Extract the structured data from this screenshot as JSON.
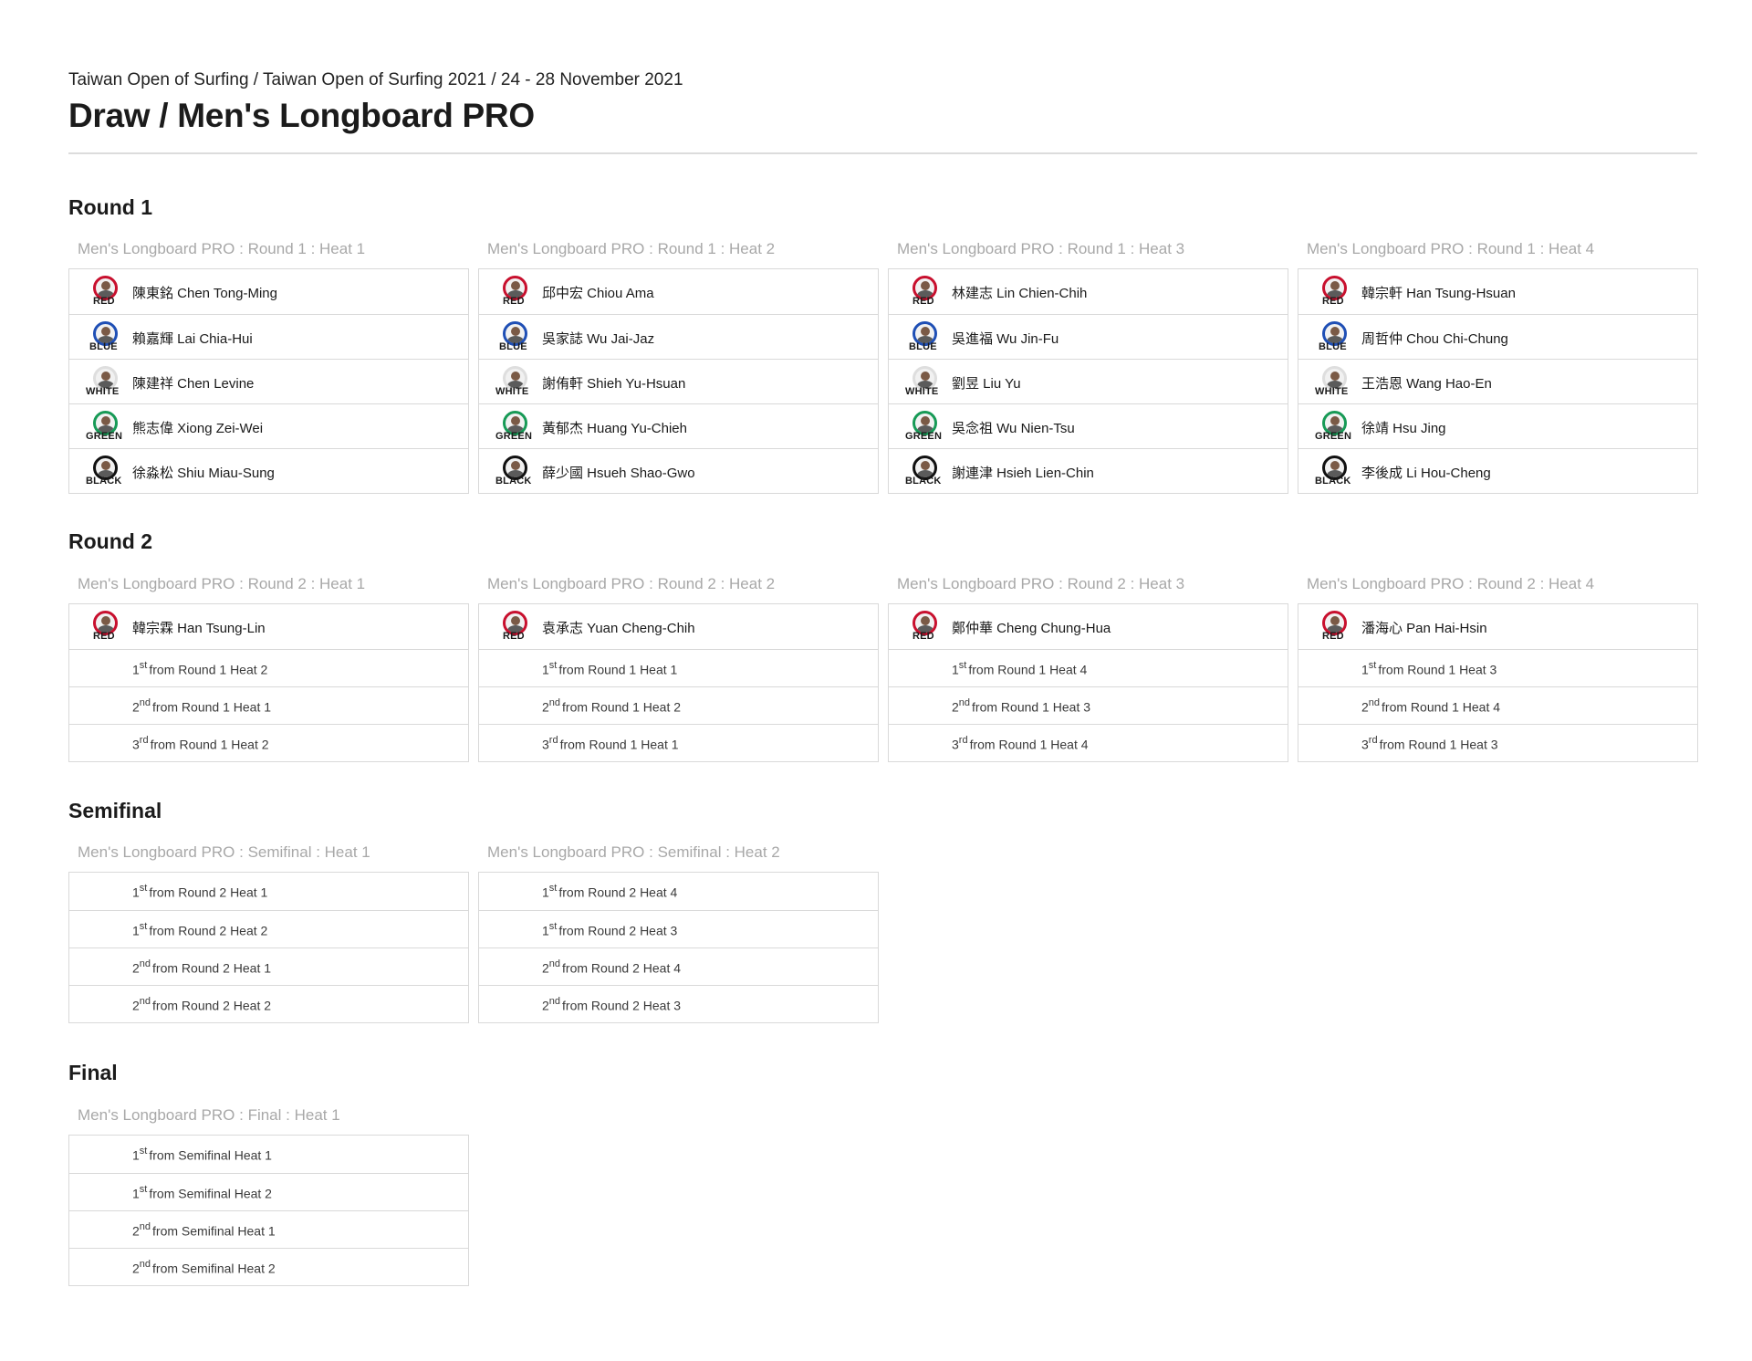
{
  "breadcrumb": "Taiwan Open of Surfing / Taiwan Open of Surfing 2021 / 24 - 28 November 2021",
  "title": "Draw / Men's Longboard PRO",
  "colors": {
    "RED": "#c8102e",
    "BLUE": "#1f4fb5",
    "WHITE": "#dedede",
    "GREEN": "#179a56",
    "BLACK": "#111111"
  },
  "rounds": [
    {
      "title": "Round 1",
      "heats": [
        {
          "label": "Men's Longboard PRO : Round 1 : Heat 1",
          "rows": [
            {
              "type": "surfer",
              "name": "陳東銘 Chen Tong-Ming",
              "color": "RED",
              "icon": "surfer-photo"
            },
            {
              "type": "surfer",
              "name": "賴嘉輝 Lai Chia-Hui",
              "color": "BLUE",
              "icon": "surfer-photo"
            },
            {
              "type": "surfer",
              "name": "陳建祥 Chen Levine",
              "color": "WHITE",
              "icon": "surfer-photo"
            },
            {
              "type": "surfer",
              "name": "熊志偉 Xiong Zei-Wei",
              "color": "GREEN",
              "icon": "surfer-photo"
            },
            {
              "type": "surfer",
              "name": "徐淼松 Shiu Miau-Sung",
              "color": "BLACK",
              "icon": "surfer-photo"
            }
          ]
        },
        {
          "label": "Men's Longboard PRO : Round 1 : Heat 2",
          "rows": [
            {
              "type": "surfer",
              "name": "邱中宏 Chiou Ama",
              "color": "RED",
              "icon": "surfer-photo"
            },
            {
              "type": "surfer",
              "name": "吳家誌 Wu Jai-Jaz",
              "color": "BLUE",
              "icon": "surfer-photo"
            },
            {
              "type": "surfer",
              "name": "謝侑軒 Shieh Yu-Hsuan",
              "color": "WHITE",
              "icon": "surfer-photo"
            },
            {
              "type": "surfer",
              "name": "黃郁杰 Huang Yu-Chieh",
              "color": "GREEN",
              "icon": "surfer-photo"
            },
            {
              "type": "surfer",
              "name": "薛少國 Hsueh Shao-Gwo",
              "color": "BLACK",
              "icon": "surfer-photo"
            }
          ]
        },
        {
          "label": "Men's Longboard PRO : Round 1 : Heat 3",
          "rows": [
            {
              "type": "surfer",
              "name": "林建志 Lin Chien-Chih",
              "color": "RED",
              "icon": "surfer-photo"
            },
            {
              "type": "surfer",
              "name": "吳進福 Wu Jin-Fu",
              "color": "BLUE",
              "icon": "surfer-photo"
            },
            {
              "type": "surfer",
              "name": "劉昱 Liu Yu",
              "color": "WHITE",
              "icon": "surfer-photo"
            },
            {
              "type": "surfer",
              "name": "吳念祖 Wu Nien-Tsu",
              "color": "GREEN",
              "icon": "surfer-photo"
            },
            {
              "type": "surfer",
              "name": "謝連津 Hsieh Lien-Chin",
              "color": "BLACK",
              "icon": "surfer-photo"
            }
          ]
        },
        {
          "label": "Men's Longboard PRO : Round 1 : Heat 4",
          "rows": [
            {
              "type": "surfer",
              "name": "韓宗軒 Han Tsung-Hsuan",
              "color": "RED",
              "icon": "surfer-photo"
            },
            {
              "type": "surfer",
              "name": "周哲仲 Chou Chi-Chung",
              "color": "BLUE",
              "icon": "surfer-photo"
            },
            {
              "type": "surfer",
              "name": "王浩恩 Wang Hao-En",
              "color": "WHITE",
              "icon": "surfer-photo"
            },
            {
              "type": "surfer",
              "name": "徐靖 Hsu Jing",
              "color": "GREEN",
              "icon": "surfer-photo"
            },
            {
              "type": "surfer",
              "name": "李後成 Li Hou-Cheng",
              "color": "BLACK",
              "icon": "surfer-photo"
            }
          ]
        }
      ]
    },
    {
      "title": "Round 2",
      "heats": [
        {
          "label": "Men's Longboard PRO : Round 2 : Heat 1",
          "rows": [
            {
              "type": "surfer",
              "name": "韓宗霖 Han Tsung-Lin",
              "color": "RED",
              "icon": "surfer-photo"
            },
            {
              "type": "slot",
              "place": "1",
              "suffix": "st",
              "text": "from Round 1 Heat 2"
            },
            {
              "type": "slot",
              "place": "2",
              "suffix": "nd",
              "text": "from Round 1 Heat 1"
            },
            {
              "type": "slot",
              "place": "3",
              "suffix": "rd",
              "text": "from Round 1 Heat 2"
            }
          ]
        },
        {
          "label": "Men's Longboard PRO : Round 2 : Heat 2",
          "rows": [
            {
              "type": "surfer",
              "name": "袁承志 Yuan Cheng-Chih",
              "color": "RED",
              "icon": "surfer-photo"
            },
            {
              "type": "slot",
              "place": "1",
              "suffix": "st",
              "text": "from Round 1 Heat 1"
            },
            {
              "type": "slot",
              "place": "2",
              "suffix": "nd",
              "text": "from Round 1 Heat 2"
            },
            {
              "type": "slot",
              "place": "3",
              "suffix": "rd",
              "text": "from Round 1 Heat 1"
            }
          ]
        },
        {
          "label": "Men's Longboard PRO : Round 2 : Heat 3",
          "rows": [
            {
              "type": "surfer",
              "name": "鄭仲華 Cheng Chung-Hua",
              "color": "RED",
              "icon": "surfer-photo"
            },
            {
              "type": "slot",
              "place": "1",
              "suffix": "st",
              "text": "from Round 1 Heat 4"
            },
            {
              "type": "slot",
              "place": "2",
              "suffix": "nd",
              "text": "from Round 1 Heat 3"
            },
            {
              "type": "slot",
              "place": "3",
              "suffix": "rd",
              "text": "from Round 1 Heat 4"
            }
          ]
        },
        {
          "label": "Men's Longboard PRO : Round 2 : Heat 4",
          "rows": [
            {
              "type": "surfer",
              "name": "潘海心 Pan Hai-Hsin",
              "color": "RED",
              "icon": "surfer-photo"
            },
            {
              "type": "slot",
              "place": "1",
              "suffix": "st",
              "text": "from Round 1 Heat 3"
            },
            {
              "type": "slot",
              "place": "2",
              "suffix": "nd",
              "text": "from Round 1 Heat 4"
            },
            {
              "type": "slot",
              "place": "3",
              "suffix": "rd",
              "text": "from Round 1 Heat 3"
            }
          ]
        }
      ]
    },
    {
      "title": "Semifinal",
      "heats": [
        {
          "label": "Men's Longboard PRO : Semifinal : Heat 1",
          "rows": [
            {
              "type": "slot",
              "place": "1",
              "suffix": "st",
              "text": "from Round 2 Heat 1"
            },
            {
              "type": "slot",
              "place": "1",
              "suffix": "st",
              "text": "from Round 2 Heat 2"
            },
            {
              "type": "slot",
              "place": "2",
              "suffix": "nd",
              "text": "from Round 2 Heat 1"
            },
            {
              "type": "slot",
              "place": "2",
              "suffix": "nd",
              "text": "from Round 2 Heat 2"
            }
          ]
        },
        {
          "label": "Men's Longboard PRO : Semifinal : Heat 2",
          "rows": [
            {
              "type": "slot",
              "place": "1",
              "suffix": "st",
              "text": "from Round 2 Heat 4"
            },
            {
              "type": "slot",
              "place": "1",
              "suffix": "st",
              "text": "from Round 2 Heat 3"
            },
            {
              "type": "slot",
              "place": "2",
              "suffix": "nd",
              "text": "from Round 2 Heat 4"
            },
            {
              "type": "slot",
              "place": "2",
              "suffix": "nd",
              "text": "from Round 2 Heat 3"
            }
          ]
        }
      ]
    },
    {
      "title": "Final",
      "heats": [
        {
          "label": "Men's Longboard PRO : Final : Heat 1",
          "rows": [
            {
              "type": "slot",
              "place": "1",
              "suffix": "st",
              "text": "from Semifinal Heat 1"
            },
            {
              "type": "slot",
              "place": "1",
              "suffix": "st",
              "text": "from Semifinal Heat 2"
            },
            {
              "type": "slot",
              "place": "2",
              "suffix": "nd",
              "text": "from Semifinal Heat 1"
            },
            {
              "type": "slot",
              "place": "2",
              "suffix": "nd",
              "text": "from Semifinal Heat 2"
            }
          ]
        }
      ]
    }
  ]
}
